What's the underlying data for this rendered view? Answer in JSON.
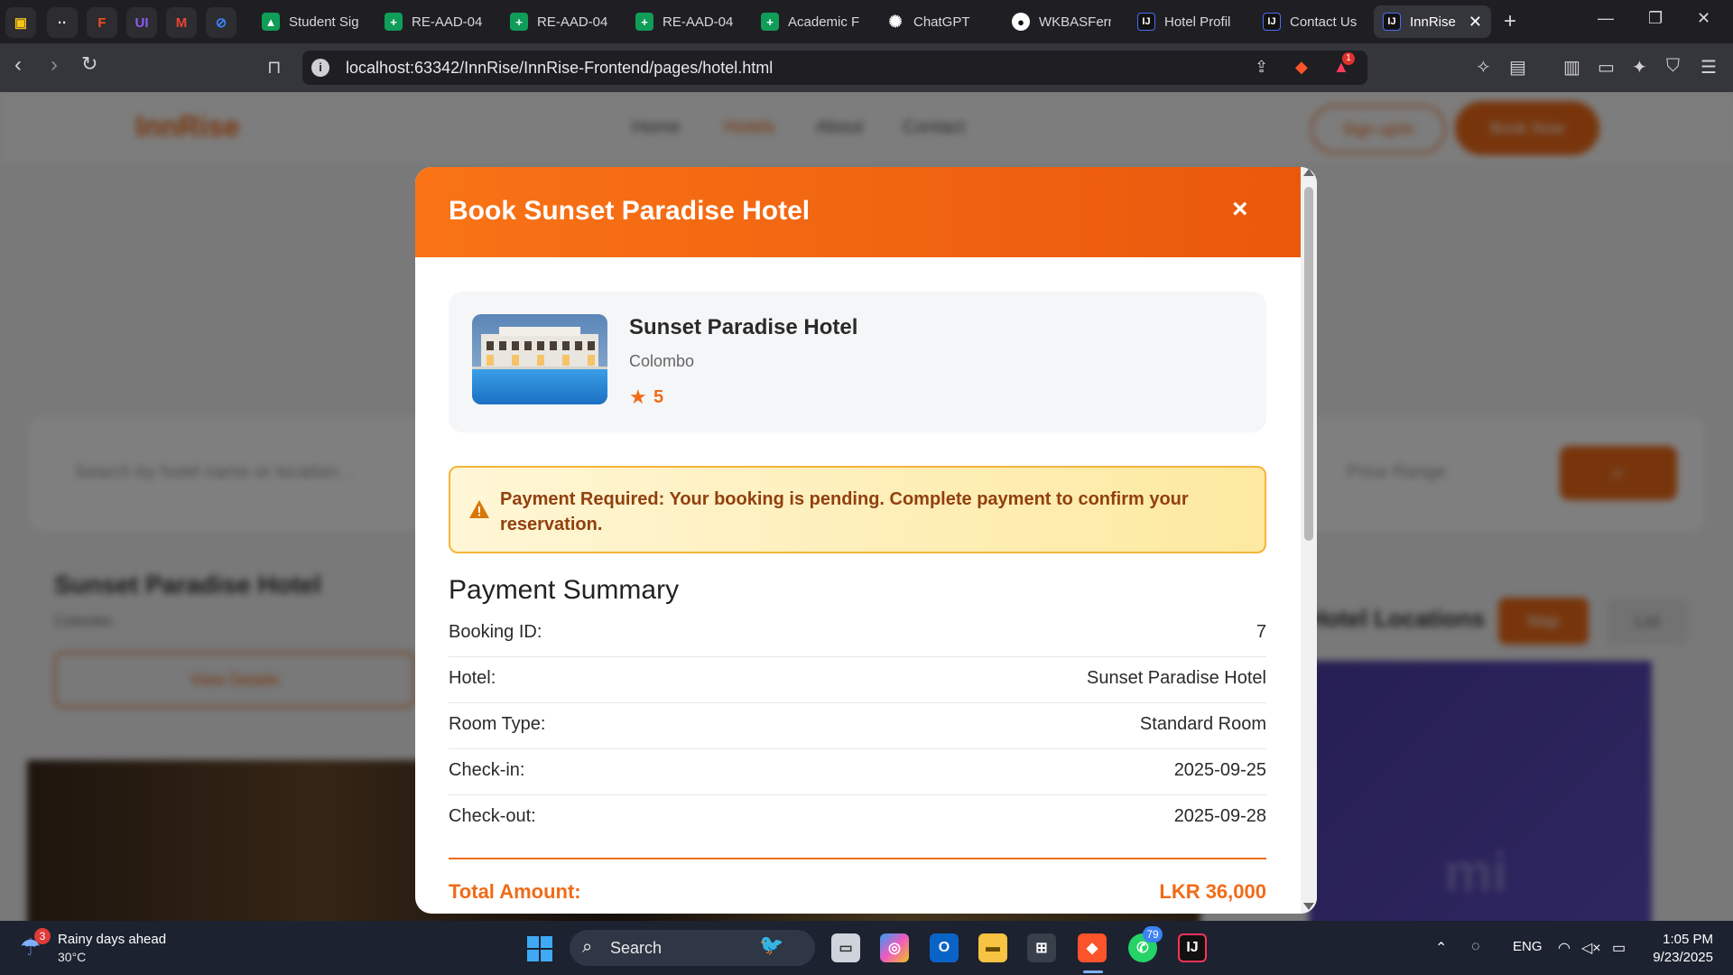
{
  "browser": {
    "pinned_tabs": [
      {
        "icon": "classroom-icon",
        "color": "#f5c518"
      },
      {
        "icon": "dots-app-icon",
        "color": "#ffffff"
      },
      {
        "icon": "figma-icon",
        "color": "#f24e1e"
      },
      {
        "icon": "ui-app-icon",
        "color": "#8b5cf6"
      },
      {
        "icon": "gmail-icon",
        "color": "#ea4335"
      },
      {
        "icon": "link-app-icon",
        "color": "#3b82f6"
      }
    ],
    "tabs": [
      {
        "title": "Student Sig",
        "icon": "google-drive-icon"
      },
      {
        "title": "RE-AAD-04",
        "icon": "google-sheets-icon"
      },
      {
        "title": "RE-AAD-04",
        "icon": "google-sheets-icon"
      },
      {
        "title": "RE-AAD-04",
        "icon": "google-sheets-icon"
      },
      {
        "title": "Academic F",
        "icon": "google-sheets-icon"
      },
      {
        "title": "ChatGPT",
        "icon": "chatgpt-icon"
      },
      {
        "title": "WKBASFern",
        "icon": "github-icon"
      },
      {
        "title": "Hotel Profil",
        "icon": "intellij-icon"
      },
      {
        "title": "Contact Us",
        "icon": "intellij-icon"
      },
      {
        "title": "InnRise",
        "icon": "intellij-icon",
        "active": true
      }
    ],
    "url": "localhost:63342/InnRise/InnRise-Frontend/pages/hotel.html",
    "brave_rewards_badge": "1"
  },
  "background_page": {
    "logo": "InnRise",
    "nav": [
      "Home",
      "Hotels",
      "About",
      "Contact"
    ],
    "btn_ghost": "Sign up/in",
    "btn_solid": "Book Now",
    "search_placeholder": "Search by hotel name or location...",
    "price_placeholder": "Price Range",
    "hotel_title": "Sunset Paradise Hotel",
    "hotel_sub": "Colombo",
    "view_details": "View Details",
    "map_title": "Hotel Locations",
    "map_btn_1": "Map",
    "map_btn_2": "List"
  },
  "modal": {
    "title": "Book Sunset Paradise Hotel",
    "close": "×",
    "hotel": {
      "name": "Sunset Paradise Hotel",
      "location": "Colombo",
      "rating": "5"
    },
    "alert": {
      "text": "Payment Required: Your booking is pending. Complete payment to confirm your reservation."
    },
    "summary": {
      "title": "Payment Summary",
      "rows": [
        {
          "label": "Booking ID:",
          "value": "7"
        },
        {
          "label": "Hotel:",
          "value": "Sunset Paradise Hotel"
        },
        {
          "label": "Room Type:",
          "value": "Standard Room"
        },
        {
          "label": "Check-in:",
          "value": "2025-09-25"
        },
        {
          "label": "Check-out:",
          "value": "2025-09-28"
        }
      ],
      "total_label": "Total Amount:",
      "total_value": "LKR 36,000"
    },
    "accent": "#f97316"
  },
  "taskbar": {
    "weather_badge": "3",
    "weather_title": "Rainy days ahead",
    "weather_temp": "30°C",
    "search": "Search",
    "whatsapp_badge": "79",
    "lang": "ENG",
    "time": "1:05 PM",
    "date": "9/23/2025"
  }
}
